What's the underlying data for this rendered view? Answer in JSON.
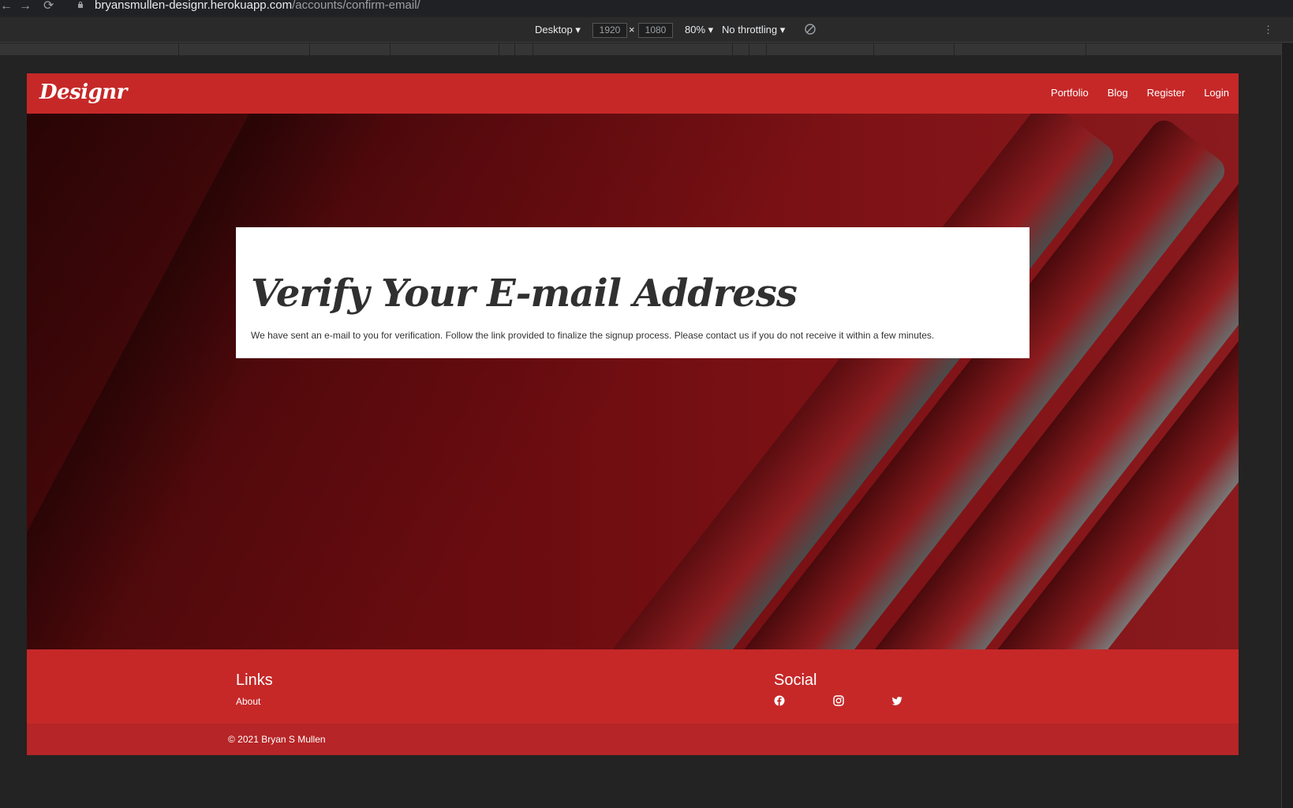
{
  "browser": {
    "url_host": "bryansmullen-designr.herokuapp.com",
    "url_path": "/accounts/confirm-email/"
  },
  "devtools": {
    "device": "Desktop",
    "width": "1920",
    "height": "1080",
    "zoom": "80%",
    "throttling": "No throttling"
  },
  "navbar": {
    "brand": "Designr",
    "links": [
      "Portfolio",
      "Blog",
      "Register",
      "Login"
    ]
  },
  "card": {
    "title": "Verify Your E-mail Address",
    "message": "We have sent an e-mail to you for verification. Follow the link provided to finalize the signup process. Please contact us if you do not receive it within a few minutes."
  },
  "footer": {
    "links_title": "Links",
    "links": [
      "About"
    ],
    "social_title": "Social",
    "social_icons": [
      "facebook-icon",
      "instagram-icon",
      "twitter-icon"
    ]
  },
  "copyright": "© 2021 Bryan S Mullen",
  "colors": {
    "brand_red": "#c62828",
    "copyright_red": "#b62527",
    "card_bg": "#ffffff",
    "title_text": "#303030"
  }
}
